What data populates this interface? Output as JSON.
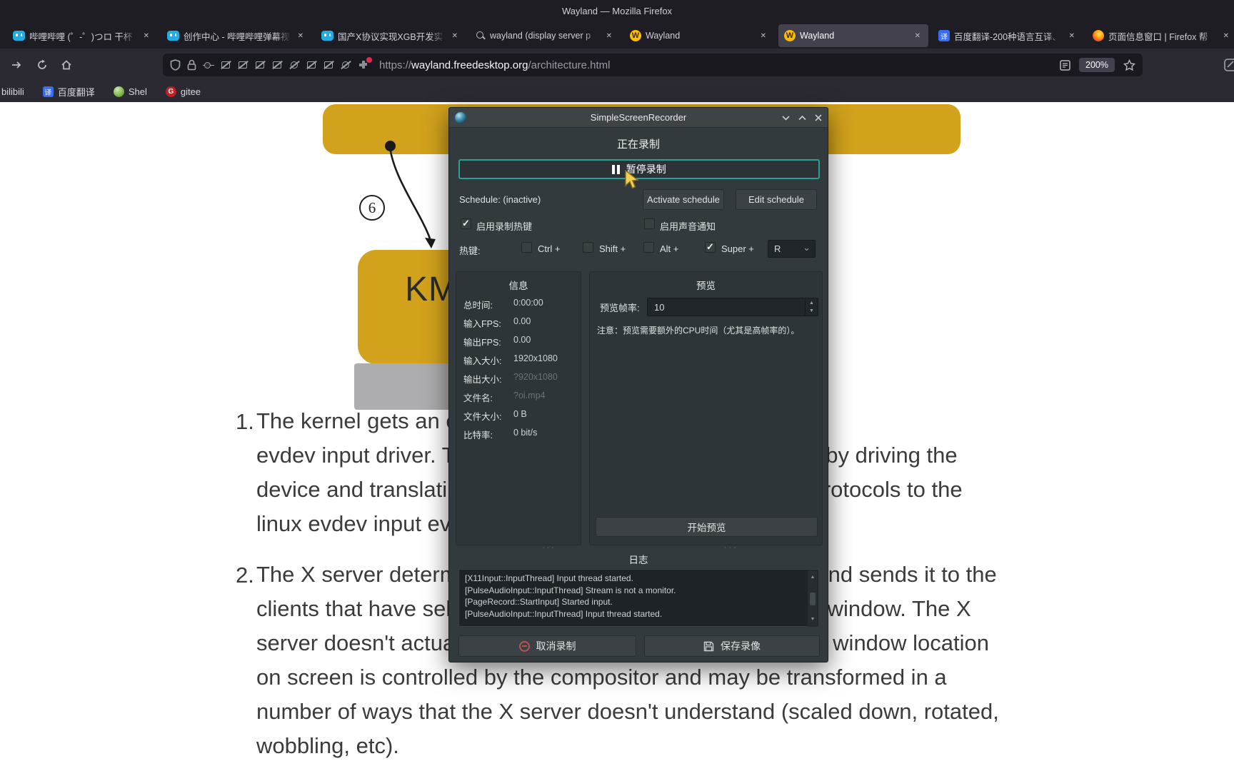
{
  "window_title": "Wayland — Mozilla Firefox",
  "glyphs": {
    "close": "✕",
    "spin_up": "▲",
    "spin_down": "▼",
    "scroll_up": "▲",
    "scroll_down": "▼",
    "grip_dots": "···",
    "dropdown_arrow": "⌄"
  },
  "browser": {
    "tabs": [
      {
        "label": "哔哩哔哩 (゜-゜)つロ 干杯",
        "icon": "bilibili-tv-icon"
      },
      {
        "label": "创作中心 - 哔哩哔哩弹幕视",
        "icon": "bilibili-tv-icon"
      },
      {
        "label": "国产X协议实现XGB开发实",
        "icon": "bilibili-tv-icon"
      },
      {
        "label": "wayland (display server p",
        "icon": "search-icon"
      },
      {
        "label": "Wayland",
        "icon": "wayland-logo-icon",
        "icon_text": "W"
      },
      {
        "label": "Wayland",
        "icon": "wayland-logo-icon",
        "icon_text": "W",
        "active": true
      },
      {
        "label": "百度翻译-200种语言互译、",
        "icon": "baidu-translate-icon",
        "icon_text": "译"
      },
      {
        "label": "页面信息窗口 | Firefox 帮",
        "icon": "firefox-icon"
      }
    ],
    "urlbar": {
      "scheme": "https://",
      "host": "wayland.freedesktop.org",
      "path": "/architecture.html",
      "zoom_level": "200%"
    },
    "bookmarks": [
      {
        "label": "bilibili"
      },
      {
        "label": "百度翻译",
        "icon_text": "译"
      },
      {
        "label": "Shel"
      },
      {
        "label": "gitee",
        "icon_text": "G"
      }
    ]
  },
  "page": {
    "diagram": {
      "kms_box_label": "KMS",
      "step_marker": "6",
      "box_color": "#d2a21c"
    },
    "paragraphs": [
      {
        "number": "1.",
        "lines": [
          "The kernel gets an event and sends it to X through the",
          "evdev input driver. The kernel does all the hard work here by driving the",
          "device and translating the different device specific event protocols to the",
          "linux evdev input event standard."
        ]
      },
      {
        "number": "2.",
        "lines": [
          "The X server determines which window the event affects and sends it to the",
          "clients that have selected for the event in question on that window. The X",
          "server doesn't actually know how to do this right, since the window location",
          "on screen is controlled by the compositor and may be transformed in a",
          "number of ways that the X server doesn't understand (scaled down, rotated,",
          "wobbling, etc)."
        ]
      }
    ]
  },
  "recorder": {
    "title": "SimpleScreenRecorder",
    "status": "正在录制",
    "pause_button": "暂停录制",
    "schedule_status": "Schedule: (inactive)",
    "activate_schedule_button": "Activate schedule",
    "edit_schedule_button": "Edit schedule",
    "enable_hotkey_checkbox": "启用录制热键",
    "enable_sound_checkbox": "启用声音通知",
    "hotkey_label": "热键:",
    "hotkey_modifiers": [
      {
        "label": "Ctrl +",
        "checked": false
      },
      {
        "label": "Shift +",
        "checked": false
      },
      {
        "label": "Alt +",
        "checked": false
      },
      {
        "label": "Super +",
        "checked": true
      }
    ],
    "hotkey_key": "R",
    "accent_color": "#2ba094",
    "info": {
      "title": "信息",
      "rows": [
        {
          "label": "总时间:",
          "value": "0:00:00"
        },
        {
          "label": "输入FPS:",
          "value": "0.00"
        },
        {
          "label": "输出FPS:",
          "value": "0.00"
        },
        {
          "label": "输入大小:",
          "value": "1920x1080"
        },
        {
          "label": "输出大小:",
          "value": "?920x1080",
          "dim": true
        },
        {
          "label": "文件名:",
          "value": "?oi.mp4",
          "dim": true
        },
        {
          "label": "文件大小:",
          "value": "0 B"
        },
        {
          "label": "比特率:",
          "value": "0 bit/s"
        }
      ]
    },
    "preview": {
      "title": "预览",
      "framerate_label": "预览帧率:",
      "framerate_value": "10",
      "note": "注意：预览需要额外的CPU时间（尤其是高帧率的）。",
      "start_button": "开始预览"
    },
    "log": {
      "title": "日志",
      "lines": [
        "[X11Input::InputThread] Input thread started.",
        "[PulseAudioInput::InputThread] Stream is not a monitor.",
        "[PageRecord::StartInput] Started input.",
        "[PulseAudioInput::InputThread] Input thread started."
      ]
    },
    "cancel_button": "取消录制",
    "save_button": "保存录像"
  }
}
